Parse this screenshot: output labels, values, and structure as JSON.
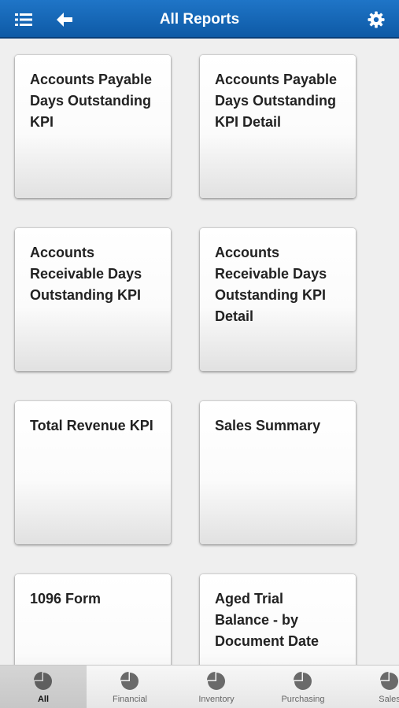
{
  "header": {
    "title": "All Reports",
    "menu_icon": "list-menu-icon",
    "back_icon": "arrow-left-icon",
    "settings_icon": "gear-icon"
  },
  "reports": [
    {
      "label": "Accounts Payable Days Outstanding KPI"
    },
    {
      "label": "Accounts Payable Days Outstanding KPI Detail"
    },
    {
      "label": "Accounts Receivable Days Outstanding KPI"
    },
    {
      "label": "Accounts Receivable Days Outstanding KPI Detail"
    },
    {
      "label": "Total Revenue KPI"
    },
    {
      "label": "Sales Summary"
    },
    {
      "label": "1096 Form"
    },
    {
      "label": "Aged Trial Balance - by Document Date"
    }
  ],
  "tabs": [
    {
      "label": "All",
      "icon": "pie-chart-icon",
      "selected": true
    },
    {
      "label": "Financial",
      "icon": "pie-chart-icon",
      "selected": false
    },
    {
      "label": "Inventory",
      "icon": "pie-chart-icon",
      "selected": false
    },
    {
      "label": "Purchasing",
      "icon": "pie-chart-icon",
      "selected": false
    },
    {
      "label": "Sales",
      "icon": "pie-chart-icon",
      "selected": false
    }
  ],
  "colors": {
    "header_blue": "#1565b8",
    "background": "#efefef",
    "tile_text": "#222222"
  }
}
